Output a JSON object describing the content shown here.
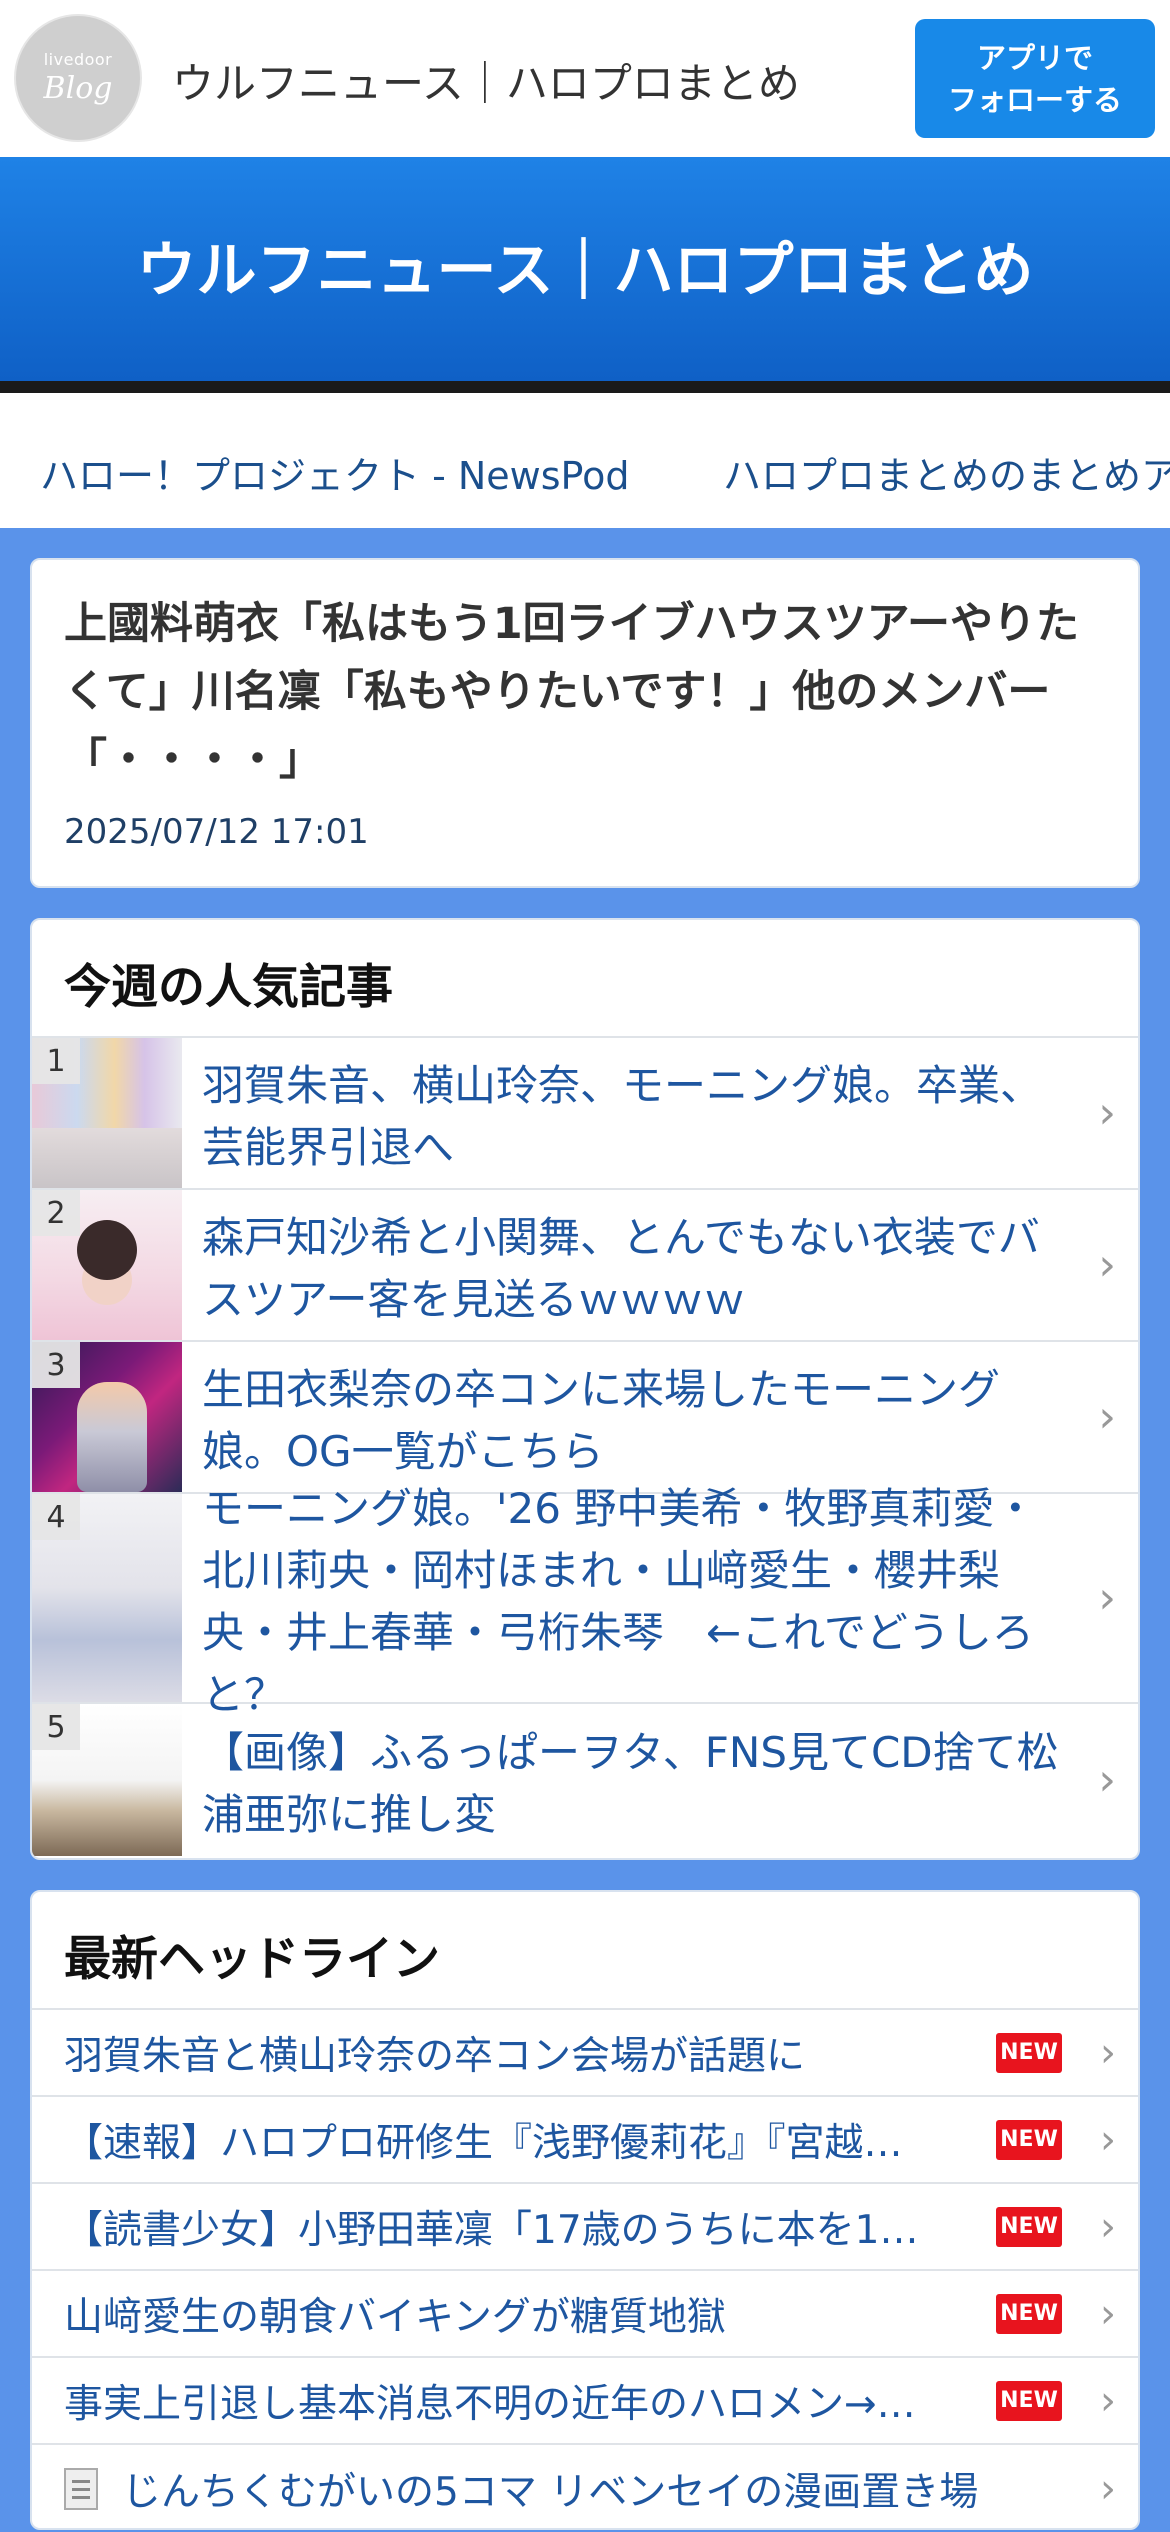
{
  "header": {
    "logo_small": "livedoor",
    "logo_big": "Blog",
    "site_title": "ウルフニュース｜ハロプロまとめ",
    "follow_line1": "アプリで",
    "follow_line2": "フォローする"
  },
  "banner": {
    "title": "ウルフニュース｜ハロプロまとめ"
  },
  "links": [
    "ハロー！プロジェクト - NewsPod",
    "ハロプロまとめのまとめア"
  ],
  "article": {
    "title": "上國料萌衣「私はもう1回ライブハウスツアーやりたくて」川名凜「私もやりたいです！」他のメンバー「・・・・」",
    "date": "2025/07/12 17:01"
  },
  "ranking": {
    "title": "今週の人気記事",
    "items": [
      {
        "no": "1",
        "text": "羽賀朱音、横山玲奈、モーニング娘。卒業、芸能界引退へ"
      },
      {
        "no": "2",
        "text": "森戸知沙希と小関舞、とんでもない衣装でバスツアー客を見送るｗｗｗｗ"
      },
      {
        "no": "3",
        "text": "生田衣梨奈の卒コンに来場したモーニング娘。OG一覧がこちら"
      },
      {
        "no": "4",
        "text": "モーニング娘。'26 野中美希・牧野真莉愛・北川莉央・岡村ほまれ・山﨑愛生・櫻井梨央・井上春華・弓桁朱琴　←これでどうしろと？"
      },
      {
        "no": "5",
        "text": "【画像】ふるっぱーヲタ、FNS見てCD捨て松浦亜弥に推し変"
      }
    ]
  },
  "headlines": {
    "title": "最新ヘッドライン",
    "new_label": "NEW",
    "items": [
      {
        "text": "羽賀朱音と横山玲奈の卒コン会場が話題に",
        "new": true
      },
      {
        "text": "【速報】ハロプロ研修生『浅野優莉花』『宮越…",
        "new": true
      },
      {
        "text": "【読書少女】小野田華凜「17歳のうちに本を1…",
        "new": true
      },
      {
        "text": "山﨑愛生の朝食バイキングが糖質地獄",
        "new": true
      },
      {
        "text": "事実上引退し基本消息不明の近年のハロメン→…",
        "new": true
      },
      {
        "text": "じんちくむがいの5コマ リベンセイの漫画置き場",
        "new": false,
        "icon": "document-icon"
      }
    ]
  }
}
